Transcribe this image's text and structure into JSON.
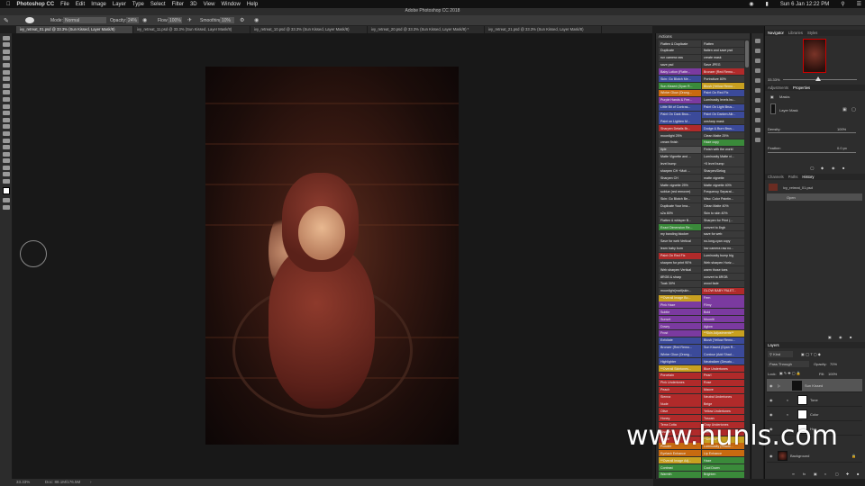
{
  "menubar": {
    "items": [
      "Photoshop CC",
      "File",
      "Edit",
      "Image",
      "Layer",
      "Type",
      "Select",
      "Filter",
      "3D",
      "View",
      "Window",
      "Help"
    ],
    "clock": "Sun 6 Jan 12:22 PM"
  },
  "window_title": "Adobe Photoshop CC 2018",
  "options": {
    "mode_label": "Mode:",
    "mode_value": "Normal",
    "opacity_label": "Opacity:",
    "opacity_value": "24%",
    "flow_label": "Flow:",
    "flow_value": "100%",
    "smoothing_label": "Smoothing:",
    "smoothing_value": "10%"
  },
  "doc_tabs": [
    "ivy_retreat_01.psd @ 33.3% (Sun Kissed, Layer Mask/8)",
    "ivy_retreat_11.psd @ 33.3% (Sun Kissed, Layer Mask/8)",
    "ivy_retreat_10.psd @ 33.3% (Sun Kissed, Layer Mask/8)",
    "ivy_retreat_20.psd @ 33.3% (Sun Kissed, Layer Mask/8) *",
    "ivy_retreat_21.psd @ 33.3% (Sun Kissed, Layer Mask/8)"
  ],
  "actions": {
    "title": "Actions",
    "rows": [
      {
        "left": "Flatten & Duplicate",
        "lc": "#3a3a3a",
        "right": "Flatten",
        "rc": "#3a3a3a"
      },
      {
        "left": "Duplicate",
        "lc": "#3a3a3a",
        "right": "flatten and save psd",
        "rc": "#3a3a3a"
      },
      {
        "left": "run camera raw",
        "lc": "#3a3a3a",
        "right": "create mask",
        "rc": "#3a3a3a"
      },
      {
        "left": "save psd",
        "lc": "#3a3a3a",
        "right": "Save JPEG",
        "rc": "#3a3a3a"
      },
      {
        "left": "Baby Lotion (Flatte...",
        "lc": "#7b3aa0",
        "right": "Bronzer (Red Remo...",
        "rc": "#b02a2a"
      },
      {
        "left": "Skin: Go Blotch Me...",
        "lc": "#3b4a9a",
        "right": "Portraiture 80%",
        "rc": "#3a3a3a"
      },
      {
        "left": "Sun-Kissed (Dyan R...",
        "lc": "#3a8a3a",
        "right": "Blush (Yellow Remo...",
        "rc": "#c8a020"
      },
      {
        "left": "Winter Glow (Orang...",
        "lc": "#c86a10",
        "right": "Paint On Red Fix",
        "rc": "#3b4a9a"
      },
      {
        "left": "Purple Hands & Fee...",
        "lc": "#7b3aa0",
        "right": "Luminosity levels bu...",
        "rc": "#3a3a3a"
      },
      {
        "left": "Little Bit of Contras...",
        "lc": "#3b4a9a",
        "right": "Paint On Light Brus...",
        "rc": "#3b4a9a"
      },
      {
        "left": "Paint On Dark Brus...",
        "lc": "#3b4a9a",
        "right": "Paint On Darken Allr...",
        "rc": "#3b4a9a"
      },
      {
        "left": "Paint on Lighten M...",
        "lc": "#3b4a9a",
        "right": "unsharp mask",
        "rc": "#3a3a3a"
      },
      {
        "left": "Sharpen Details Br...",
        "lc": "#b02a2a",
        "right": "Dodge & Burn Brus...",
        "rc": "#3b4a9a"
      },
      {
        "left": "moonlight 25%",
        "lc": "#3a3a3a",
        "right": "Clean Matte 25%",
        "rc": "#3a3a3a"
      },
      {
        "left": "cream finish",
        "lc": "#3a3a3a",
        "right": "Haze copy",
        "rc": "#3a8a3a"
      },
      {
        "left": "tiple",
        "lc": "#555555",
        "right": "Finish with the world",
        "rc": "#3a3a3a"
      },
      {
        "left": "Matte Vignette and ...",
        "lc": "#3a3a3a",
        "right": "Luminosity Matte vi...",
        "rc": "#3a3a3a"
      },
      {
        "left": "level bump",
        "lc": "#3a3a3a",
        "right": "+5 level bump",
        "rc": "#3a3a3a"
      },
      {
        "left": "sharpen CH +Moti ...",
        "lc": "#3a3a3a",
        "right": "Sharpen/Delog",
        "rc": "#3a3a3a"
      },
      {
        "left": "Sharpen CH",
        "lc": "#3a3a3a",
        "right": "matte vignette",
        "rc": "#3a3a3a"
      },
      {
        "left": "Matte vignette 25%",
        "lc": "#3a3a3a",
        "right": "Matte vignette 40%",
        "rc": "#3a3a3a"
      },
      {
        "left": "soblue (red remover)",
        "lc": "#3a3a3a",
        "right": "Frequency Separat...",
        "rc": "#3a3a3a"
      },
      {
        "left": "Skin: Go Blotch Be...",
        "lc": "#3a3a3a",
        "right": "Misc: Color Paintin...",
        "rc": "#3a3a3a"
      },
      {
        "left": "Duplicate Your Ima...",
        "lc": "#3a3a3a",
        "right": "Clean Matte 40%",
        "rc": "#3a3a3a"
      },
      {
        "left": "s2a 80%",
        "lc": "#3a3a3a",
        "right": "Skin to skin 40%",
        "rc": "#3a3a3a"
      },
      {
        "left": "Flatten & whisper B...",
        "lc": "#3a3a3a",
        "right": "Sharpen for Print (...",
        "rc": "#3a3a3a"
      },
      {
        "left": "Exact Dimension Re...",
        "lc": "#3a8a3a",
        "right": "convert to 8rgb",
        "rc": "#3a3a3a"
      },
      {
        "left": "my banding blocker",
        "lc": "#3a3a3a",
        "right": "save for web",
        "rc": "#3a3a3a"
      },
      {
        "left": "Save for web Vertical",
        "lc": "#3a3a3a",
        "right": "no-long-cyan copy",
        "rc": "#3a3a3a"
      },
      {
        "left": "learn baby burn",
        "lc": "#3a3a3a",
        "right": "low camera raw no...",
        "rc": "#3a3a3a"
      },
      {
        "left": "Paint On Red Fix",
        "lc": "#b02a2a",
        "right": "Luminosity bump big",
        "rc": "#3a3a3a"
      },
      {
        "left": "sharpen for print 90%",
        "lc": "#3a3a3a",
        "right": "Web sharpen Horiz...",
        "rc": "#3a3a3a"
      },
      {
        "left": "Web sharpen Vertical",
        "lc": "#3a3a3a",
        "right": "warm those toes",
        "rc": "#3a3a3a"
      },
      {
        "left": "8RGB & sharp",
        "lc": "#3a3a3a",
        "right": "convert to 8RGB",
        "rc": "#3a3a3a"
      },
      {
        "left": "Tuak 30%",
        "lc": "#3a3a3a",
        "right": "wood fade",
        "rc": "#3a3a3a"
      },
      {
        "left": "moonlight(matt)skin...",
        "lc": "#3a3a3a",
        "right": "GLOW BABY PALET...",
        "rc": "#b02a2a"
      },
      {
        "left": "**Overall Image Bo...",
        "lc": "#c8a020",
        "right": "Fern",
        "rc": "#7b3aa0"
      },
      {
        "left": "Pink Haze",
        "lc": "#7b3aa0",
        "right": "Filmy",
        "rc": "#7b3aa0"
      },
      {
        "left": "Subtle",
        "lc": "#7b3aa0",
        "right": "Bold",
        "rc": "#7b3aa0"
      },
      {
        "left": "Sunset",
        "lc": "#7b3aa0",
        "right": "Moonlit",
        "rc": "#7b3aa0"
      },
      {
        "left": "Dowry",
        "lc": "#7b3aa0",
        "right": "Aglow",
        "rc": "#7b3aa0"
      },
      {
        "left": "Frost",
        "lc": "#7b3aa0",
        "right": "**Skin Adjustments**",
        "rc": "#c8a020"
      },
      {
        "left": "Exfoliate",
        "lc": "#3b4a9a",
        "right": "Blush (Yellow Remo...",
        "rc": "#3b4a9a"
      },
      {
        "left": "Bronzer (Red Remo...",
        "lc": "#3b4a9a",
        "right": "Sun Kissed (Dyan R...",
        "rc": "#3b4a9a"
      },
      {
        "left": "Winter Glow (Orang...",
        "lc": "#3b4a9a",
        "right": "Contour (Add Shad...",
        "rc": "#3b4a9a"
      },
      {
        "left": "Highlighter",
        "lc": "#3b4a9a",
        "right": "Neutralizer (Desatu...",
        "rc": "#3b4a9a"
      },
      {
        "left": "**Overall Skintones...",
        "lc": "#c8a020",
        "right": "Blue Undertones",
        "rc": "#b02a2a"
      },
      {
        "left": "Porcelain",
        "lc": "#b02a2a",
        "right": "Pearl",
        "rc": "#b02a2a"
      },
      {
        "left": "Pink Undertones",
        "lc": "#b02a2a",
        "right": "Rose",
        "rc": "#b02a2a"
      },
      {
        "left": "Peach",
        "lc": "#b02a2a",
        "right": "Mauve",
        "rc": "#b02a2a"
      },
      {
        "left": "Sienna",
        "lc": "#b02a2a",
        "right": "Neutral Undertones",
        "rc": "#b02a2a"
      },
      {
        "left": "Nude",
        "lc": "#b02a2a",
        "right": "Beige",
        "rc": "#b02a2a"
      },
      {
        "left": "Olive",
        "lc": "#b02a2a",
        "right": "Yellow Undertones",
        "rc": "#b02a2a"
      },
      {
        "left": "Honey",
        "lc": "#b02a2a",
        "right": "Tuscan",
        "rc": "#b02a2a"
      },
      {
        "left": "Terra Cotta",
        "lc": "#b02a2a",
        "right": "Gray Undertones",
        "rc": "#b02a2a"
      },
      {
        "left": "Bisque",
        "lc": "#b02a2a",
        "right": "Silver",
        "rc": "#b02a2a"
      },
      {
        "left": "Taupe",
        "lc": "#b02a2a",
        "right": "**Details**",
        "rc": "#c8a020"
      },
      {
        "left": "Powder",
        "lc": "#c86a10",
        "right": "Luminosity (Shado...",
        "rc": "#c86a10"
      },
      {
        "left": "Eyelash Enhance",
        "lc": "#c86a10",
        "right": "Lip Enhance",
        "rc": "#c86a10"
      },
      {
        "left": "**Overall Image Adj...",
        "lc": "#c8a020",
        "right": "Haze",
        "rc": "#3a8a3a"
      },
      {
        "left": "Contrast",
        "lc": "#3a8a3a",
        "right": "Cool Down",
        "rc": "#3a8a3a"
      },
      {
        "left": "Warmth",
        "lc": "#3a8a3a",
        "right": "Brighten",
        "rc": "#3a8a3a"
      }
    ]
  },
  "navigator": {
    "tabs": [
      "Navigator",
      "Libraries",
      "Styles"
    ],
    "zoom": "33.33%"
  },
  "properties": {
    "tabs": [
      "Adjustments",
      "Properties"
    ],
    "masks_label": "Masks",
    "layer_mask_label": "Layer Mask",
    "density_label": "Density:",
    "density_value": "100%",
    "feather_label": "Feather:",
    "feather_value": "0.0 px"
  },
  "history": {
    "tabs": [
      "Channels",
      "Paths",
      "History"
    ],
    "snapshot": "ivy_retreat_01.psd",
    "steps": [
      "Open"
    ]
  },
  "layers": {
    "title": "Layers",
    "kind_label": "Kind",
    "blend_mode": "Pass Through",
    "opacity_label": "Opacity:",
    "opacity_value": "70%",
    "lock_label": "Lock:",
    "fill_label": "Fill:",
    "fill_value": "100%",
    "items": [
      "Sun Kissed",
      "Tone",
      "Color",
      "Hue",
      "Background"
    ]
  },
  "status": {
    "zoom": "33.33%",
    "doc": "Doc: 88.1M/176.5M"
  },
  "watermark": "www.hunls.com"
}
